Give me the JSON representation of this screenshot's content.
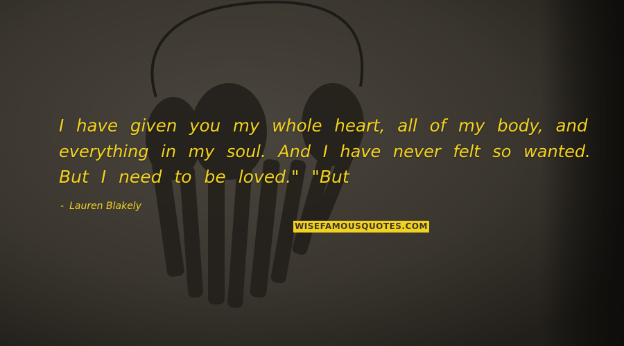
{
  "quote": {
    "lines": [
      "I have given you my whole heart, all of my body, and",
      "everything in my soul. And I have never felt so wanted.",
      "But I need to be loved.\" \"But"
    ],
    "author_dash": "-",
    "author": "Lauren Blakely"
  },
  "watermark": {
    "text": "WISEFAMOUSQUOTES.COM"
  },
  "colors": {
    "text": "#f2d21e",
    "background": "#3a362f"
  },
  "background_image": {
    "icon": "ring-of-old-keys"
  }
}
